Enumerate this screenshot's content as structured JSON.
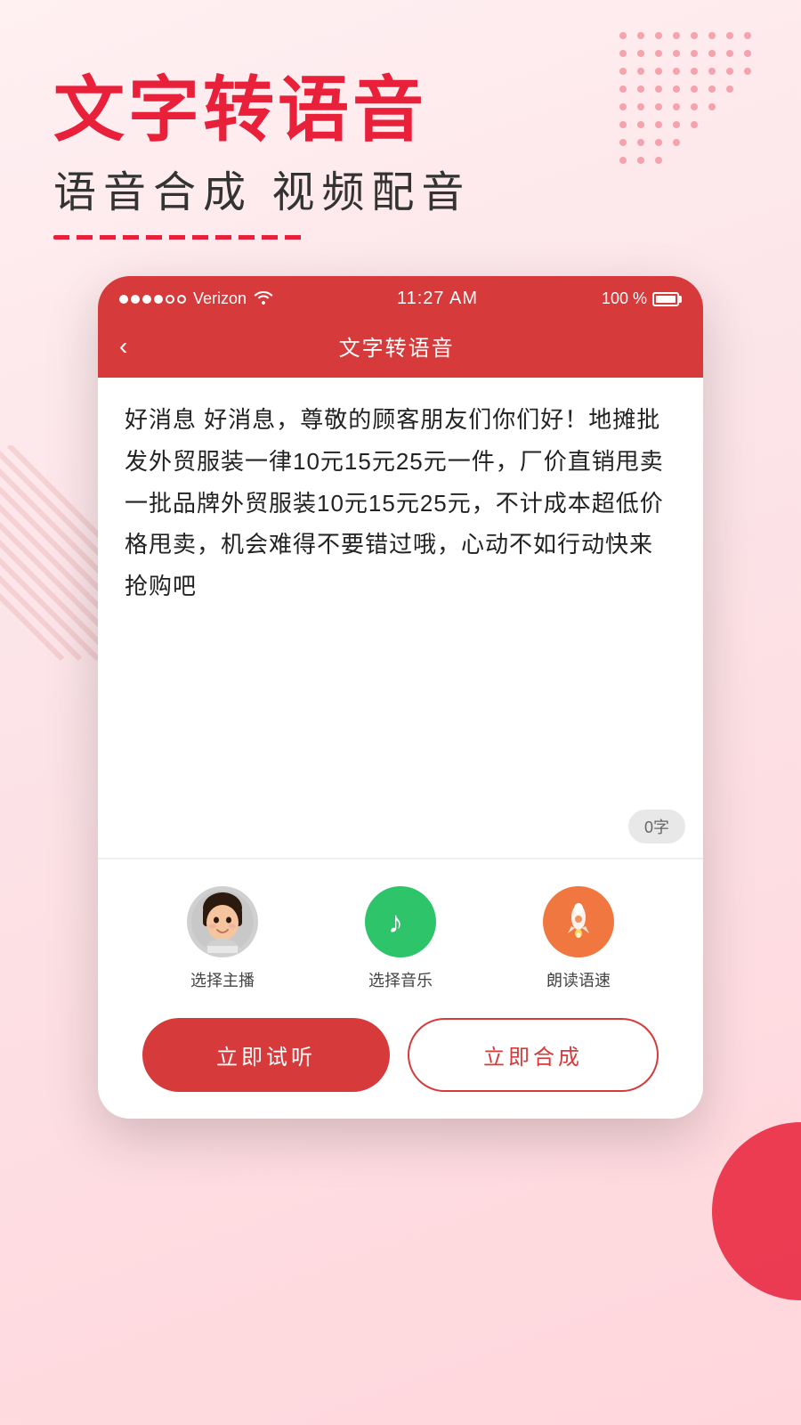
{
  "hero": {
    "title": "文字转语音",
    "subtitle": "语音合成 视频配音"
  },
  "statusBar": {
    "carrier": "Verizon",
    "time": "11:27 AM",
    "battery": "100 %"
  },
  "appHeader": {
    "back": "‹",
    "title": "文字转语音"
  },
  "textContent": "好消息 好消息，尊敬的顾客朋友们你们好！地摊批发外贸服装一律10元15元25元一件，厂价直销甩卖一批品牌外贸服装10元15元25元，不计成本超低价格甩卖，机会难得不要错过哦，心动不如行动快来抢购吧",
  "charCount": "0字",
  "controls": [
    {
      "id": "anchor",
      "label": "选择主播",
      "type": "avatar"
    },
    {
      "id": "music",
      "label": "选择音乐",
      "type": "music"
    },
    {
      "id": "speed",
      "label": "朗读语速",
      "type": "speed"
    }
  ],
  "buttons": {
    "listen": "立即试听",
    "compose": "立即合成"
  }
}
